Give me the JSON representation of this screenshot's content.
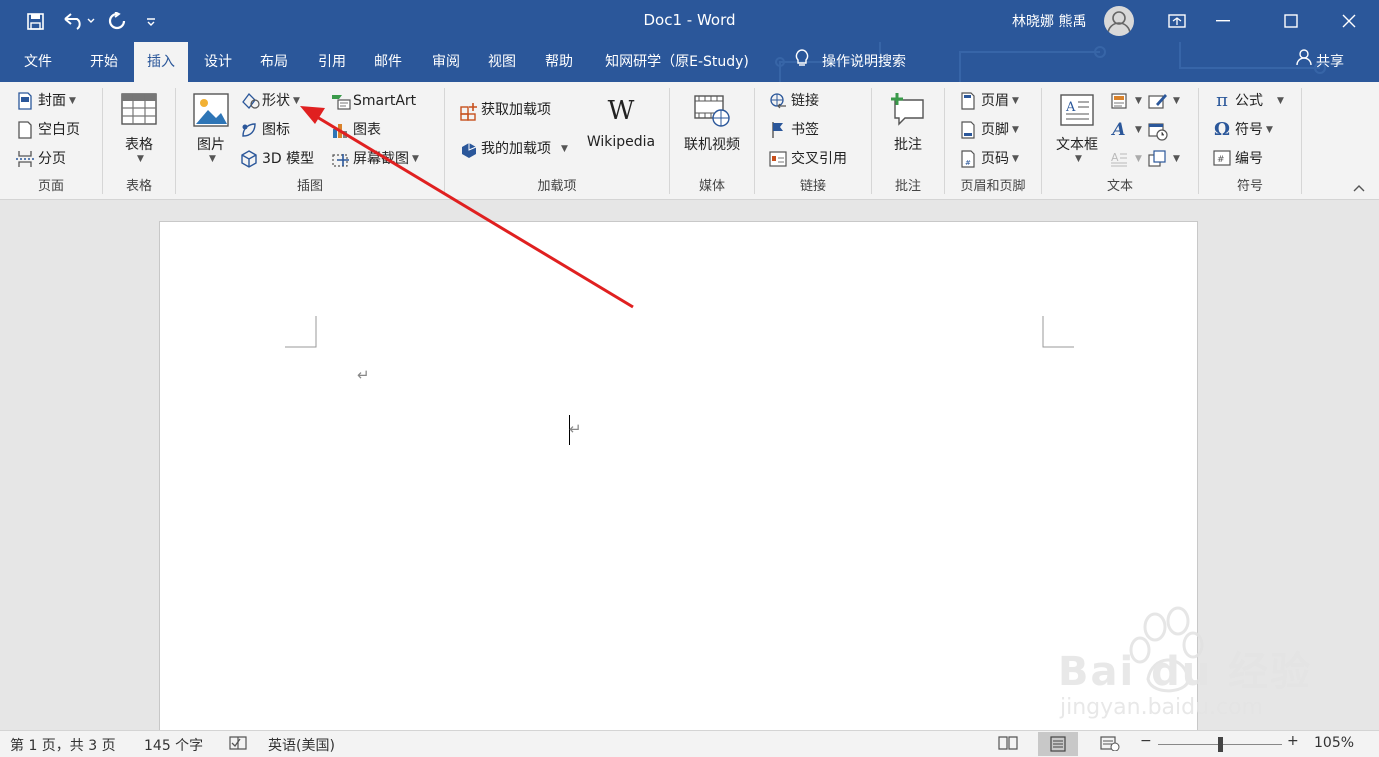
{
  "titlebar": {
    "doc_title": "Doc1  -  Word",
    "user_name": "林晓娜 熊禹"
  },
  "tabs": [
    {
      "label": "文件"
    },
    {
      "label": "开始"
    },
    {
      "label": "插入"
    },
    {
      "label": "设计"
    },
    {
      "label": "布局"
    },
    {
      "label": "引用"
    },
    {
      "label": "邮件"
    },
    {
      "label": "审阅"
    },
    {
      "label": "视图"
    },
    {
      "label": "帮助"
    },
    {
      "label": "知网研学（原E-Study)"
    }
  ],
  "tell_me": "操作说明搜索",
  "share": "共享",
  "ribbon": {
    "pages": {
      "label": "页面",
      "cover": "封面",
      "blank": "空白页",
      "break": "分页"
    },
    "tables": {
      "label": "表格",
      "table": "表格"
    },
    "illustrations": {
      "label": "插图",
      "pictures": "图片",
      "shapes": "形状",
      "icons": "图标",
      "model3d": "3D 模型",
      "smartart": "SmartArt",
      "chart": "图表",
      "screenshot": "屏幕截图"
    },
    "addins": {
      "label": "加载项",
      "get": "获取加载项",
      "my": "我的加载项",
      "wikipedia": "Wikipedia",
      "wiki_logo": "W"
    },
    "media": {
      "label": "媒体",
      "video": "联机视频"
    },
    "links": {
      "label": "链接",
      "link": "链接",
      "bookmark": "书签",
      "crossref": "交叉引用"
    },
    "comments": {
      "label": "批注",
      "comment": "批注"
    },
    "header_footer": {
      "label": "页眉和页脚",
      "header": "页眉",
      "footer": "页脚",
      "page_number": "页码"
    },
    "text": {
      "label": "文本",
      "textbox": "文本框"
    },
    "symbols": {
      "label": "符号",
      "equation": "公式",
      "symbol": "符号",
      "number": "编号",
      "pi": "π",
      "omega": "Ω"
    }
  },
  "status": {
    "page": "第 1 页，共 3 页",
    "words": "145 个字",
    "language": "英语(美国)",
    "zoom": "105%",
    "zoom_minus": "−",
    "zoom_plus": "+"
  },
  "document": {
    "paragraph_mark": "↵"
  },
  "watermark": {
    "brand": "Bai du 经验",
    "url": "jingyan.baidu.com"
  },
  "colors": {
    "accent": "#2b579a",
    "arrow": "#e02020"
  }
}
